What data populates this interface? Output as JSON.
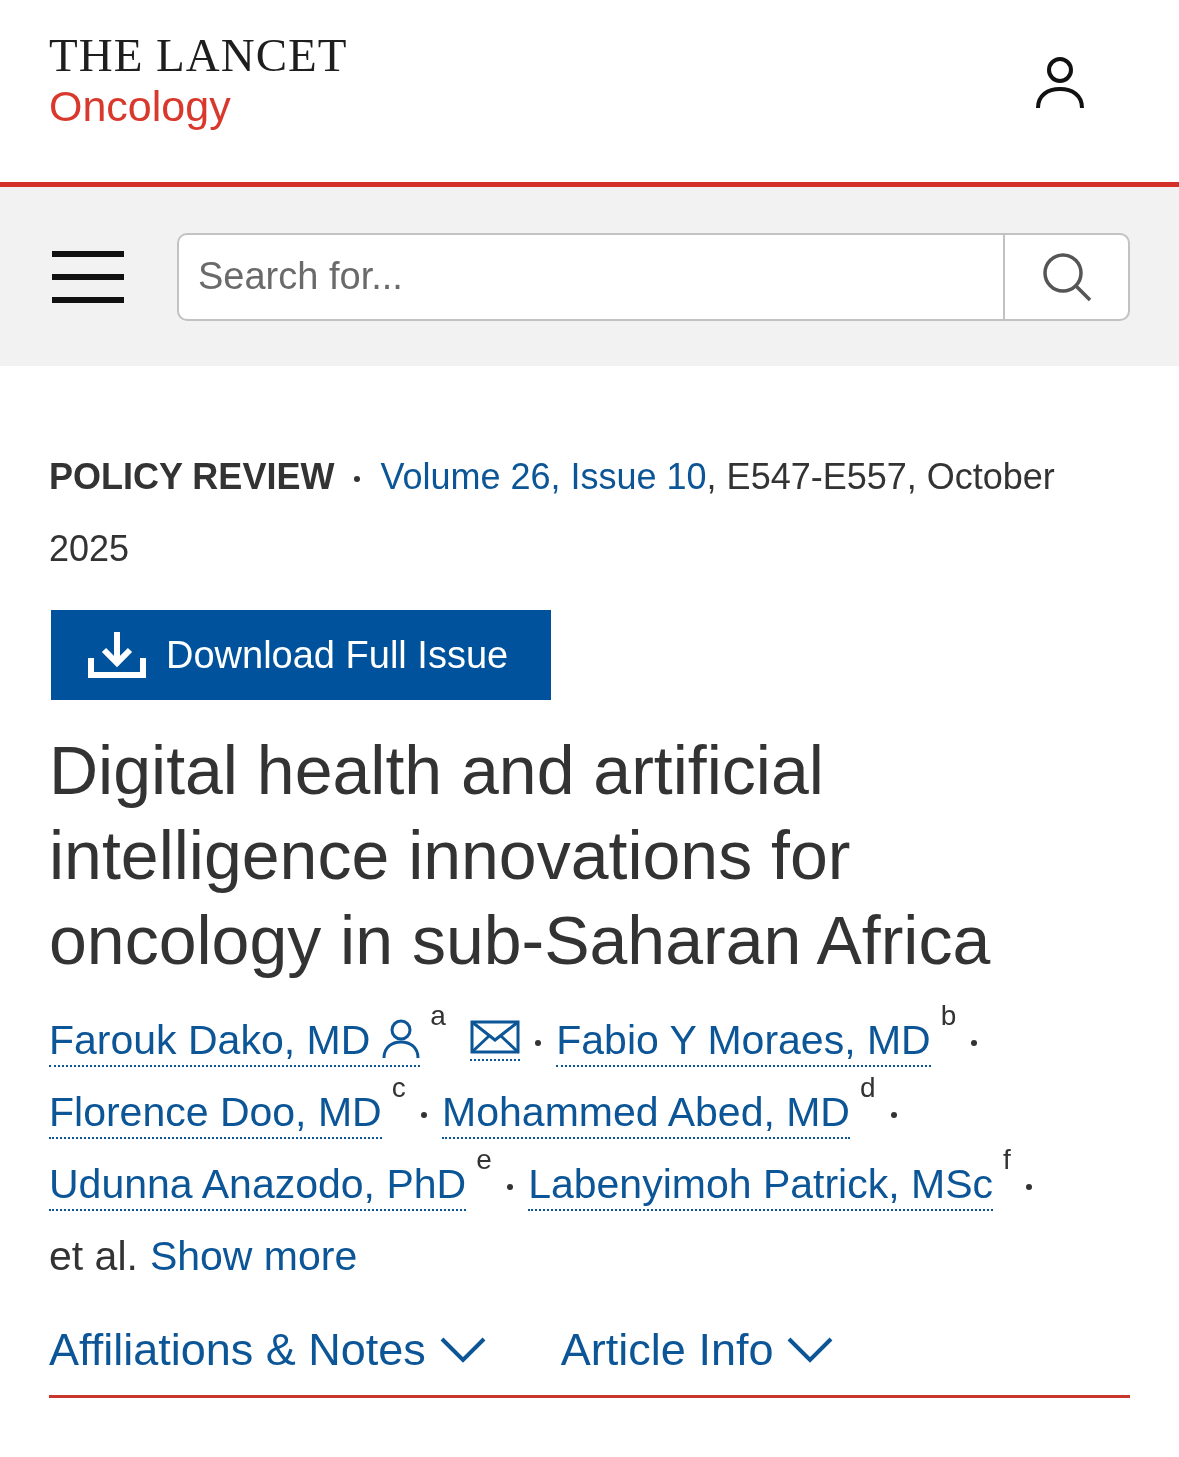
{
  "header": {
    "logo_title": "THE LANCET",
    "logo_subtitle": "Oncology"
  },
  "search": {
    "placeholder": "Search for..."
  },
  "article": {
    "category": "POLICY REVIEW",
    "issue_link": "Volume 26, Issue 10",
    "citation": ", E547-E557, October 2025",
    "download_button": "Download Full Issue",
    "title": "Digital health and artificial intelligence innovations for oncology in sub-Saharan Africa",
    "authors": [
      {
        "name": "Farouk Dako, MD",
        "affiliation": "a",
        "corresponding": true
      },
      {
        "name": "Fabio Y Moraes, MD",
        "affiliation": "b",
        "corresponding": false
      },
      {
        "name": "Florence Doo, MD",
        "affiliation": "c",
        "corresponding": false
      },
      {
        "name": "Mohammed Abed, MD",
        "affiliation": "d",
        "corresponding": false
      },
      {
        "name": "Udunna Anazodo, PhD",
        "affiliation": "e",
        "corresponding": false
      },
      {
        "name": "Labenyimoh Patrick, MSc",
        "affiliation": "f",
        "corresponding": false
      }
    ],
    "et_al": "et al.",
    "show_more": "Show more"
  },
  "tabs": [
    {
      "label": "Affiliations & Notes",
      "expanded": false
    },
    {
      "label": "Article Info",
      "expanded": false
    }
  ]
}
